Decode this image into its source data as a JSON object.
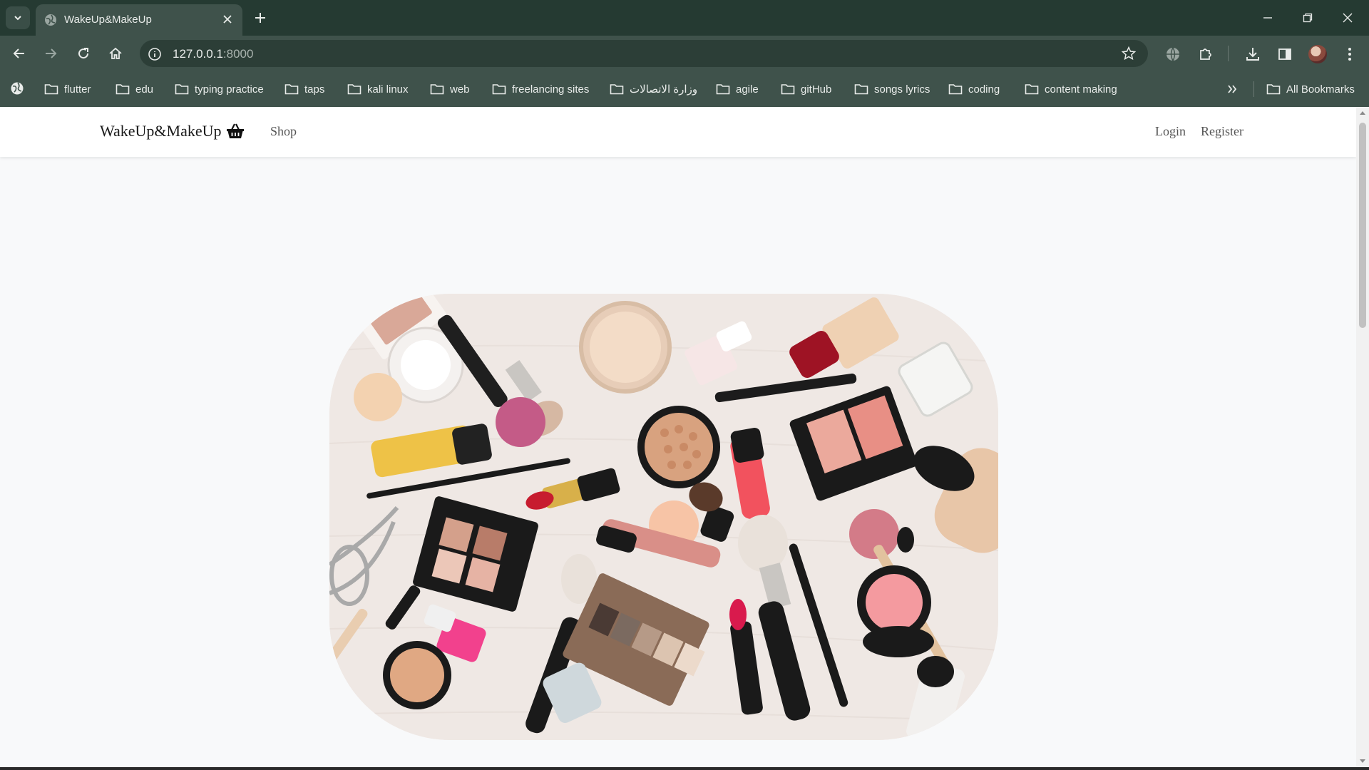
{
  "browser": {
    "tab_title": "WakeUp&MakeUp",
    "url_host": "127.0.0.1",
    "url_port": ":8000",
    "bookmarks": [
      "flutter",
      "edu",
      "typing practice",
      "taps",
      "kali linux",
      "web",
      "freelancing sites",
      "وزارة الاتصالات",
      "agile",
      "gitHub",
      "songs lyrics",
      "coding",
      "content making"
    ],
    "all_bookmarks_label": "All Bookmarks"
  },
  "navbar": {
    "brand": "WakeUp&MakeUp",
    "shop_label": "Shop",
    "login_label": "Login",
    "register_label": "Register"
  },
  "hero": {
    "image_description_icon": "makeup-products-image"
  },
  "colors": {
    "chrome_dark": "#253a32",
    "chrome": "#3f524b",
    "page_bg": "#f8f9fa"
  }
}
